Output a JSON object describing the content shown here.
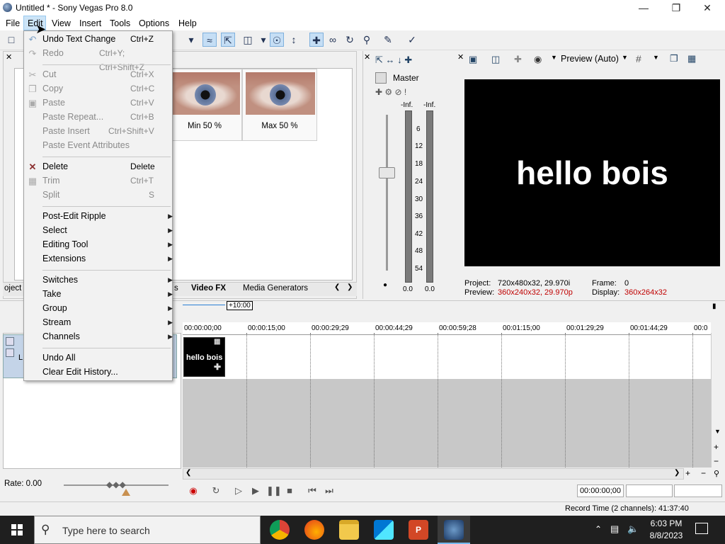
{
  "window": {
    "title": "Untitled * - Sony Vegas Pro 8.0"
  },
  "menubar": [
    "File",
    "Edit",
    "View",
    "Insert",
    "Tools",
    "Options",
    "Help"
  ],
  "edit_menu": {
    "items": [
      {
        "label": "Undo Text Change",
        "shortcut": "Ctrl+Z",
        "disabled": false
      },
      {
        "label": "Redo",
        "shortcut": "Ctrl+Y; Ctrl+Shift+Z",
        "disabled": true
      },
      {
        "label": "Cut",
        "shortcut": "Ctrl+X",
        "disabled": true
      },
      {
        "label": "Copy",
        "shortcut": "Ctrl+C",
        "disabled": true
      },
      {
        "label": "Paste",
        "shortcut": "Ctrl+V",
        "disabled": true
      },
      {
        "label": "Paste Repeat...",
        "shortcut": "Ctrl+B",
        "disabled": true
      },
      {
        "label": "Paste Insert",
        "shortcut": "Ctrl+Shift+V",
        "disabled": true
      },
      {
        "label": "Paste Event Attributes",
        "shortcut": "",
        "disabled": true
      },
      {
        "label": "Delete",
        "shortcut": "Delete",
        "disabled": false
      },
      {
        "label": "Trim",
        "shortcut": "Ctrl+T",
        "disabled": true
      },
      {
        "label": "Split",
        "shortcut": "S",
        "disabled": true
      },
      {
        "label": "Post-Edit Ripple",
        "shortcut": "",
        "disabled": false,
        "submenu": true
      },
      {
        "label": "Select",
        "shortcut": "",
        "disabled": false,
        "submenu": true
      },
      {
        "label": "Editing Tool",
        "shortcut": "",
        "disabled": false,
        "submenu": true
      },
      {
        "label": "Extensions",
        "shortcut": "",
        "disabled": false,
        "submenu": true
      },
      {
        "label": "Switches",
        "shortcut": "",
        "disabled": false,
        "submenu": true
      },
      {
        "label": "Take",
        "shortcut": "",
        "disabled": false,
        "submenu": true
      },
      {
        "label": "Group",
        "shortcut": "",
        "disabled": false,
        "submenu": true
      },
      {
        "label": "Stream",
        "shortcut": "",
        "disabled": false,
        "submenu": true
      },
      {
        "label": "Channels",
        "shortcut": "",
        "disabled": false,
        "submenu": true
      },
      {
        "label": "Undo All",
        "shortcut": "",
        "disabled": false
      },
      {
        "label": "Clear Edit History...",
        "shortcut": "",
        "disabled": false
      }
    ]
  },
  "fx_thumbs": [
    {
      "label": "Min 50 %"
    },
    {
      "label": "Max 50 %"
    }
  ],
  "tabs": {
    "left_partial": "oject",
    "s_partial": "s",
    "video_fx": "Video FX",
    "media_generators": "Media Generators"
  },
  "mixer": {
    "title": "Master",
    "inf_left": "-Inf.",
    "inf_right": "-Inf.",
    "scale": [
      "6",
      "12",
      "18",
      "24",
      "30",
      "36",
      "42",
      "48",
      "54"
    ],
    "level_left": "0.0",
    "level_right": "0.0"
  },
  "preview": {
    "mode_label": "Preview (Auto)",
    "overlay_text": "hello bois",
    "project_label": "Project:",
    "project_value": "720x480x32, 29.970i",
    "preview_label": "Preview:",
    "preview_value": "360x240x32, 29.970p",
    "frame_label": "Frame:",
    "frame_value": "0",
    "display_label": "Display:",
    "display_value": "360x264x32"
  },
  "timeline": {
    "offset_label": "+10:00",
    "ticks": [
      "00:00:00;00",
      "00:00:15;00",
      "00:00:29;29",
      "00:00:44;29",
      "00:00:59;28",
      "00:01:15;00",
      "00:01:29;29",
      "00:01:44;29",
      "00:0"
    ],
    "clip_text": "hello bois",
    "track_letter": "L"
  },
  "transport": {
    "rate": "Rate: 0.00",
    "timecode": "00:00:00;00"
  },
  "status": {
    "record_time": "Record Time (2 channels): 41:37:40"
  },
  "taskbar": {
    "search_placeholder": "Type here to search",
    "time": "6:03 PM",
    "date": "8/8/2023"
  }
}
